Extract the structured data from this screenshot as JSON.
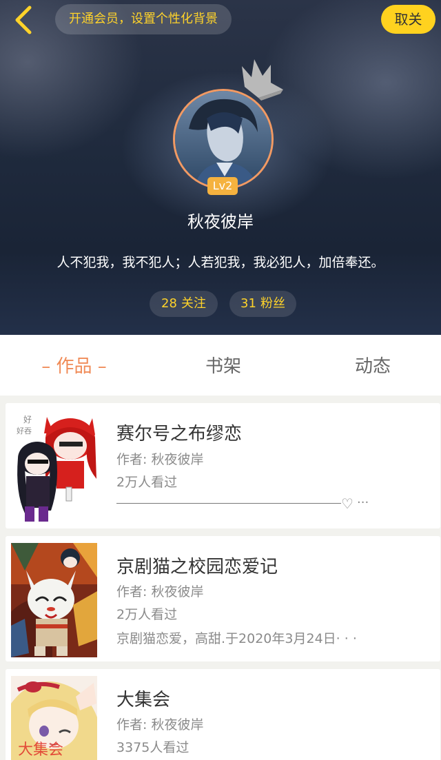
{
  "header": {
    "vip_prompt": "开通会员，设置个性化背景",
    "unfollow_label": "取关",
    "level": "Lv2",
    "username": "秋夜彼岸",
    "signature": "人不犯我，我不犯人；人若犯我，我必犯人，加倍奉还。",
    "following": {
      "count": "28",
      "label": "关注"
    },
    "followers": {
      "count": "31",
      "label": "粉丝"
    }
  },
  "tabs": [
    {
      "label": "– 作品 –",
      "active": true
    },
    {
      "label": "书架",
      "active": false
    },
    {
      "label": "动态",
      "active": false
    }
  ],
  "works": [
    {
      "title": "赛尔号之布缪恋",
      "author": "作者: 秋夜彼岸",
      "views": "2万人看过",
      "description": "",
      "icons": [
        "heart-icon",
        "more-icon"
      ]
    },
    {
      "title": "京剧猫之校园恋爱记",
      "author": "作者: 秋夜彼岸",
      "views": "2万人看过",
      "description": "京剧猫恋爱，高甜.于2020年3月24日· · ·"
    },
    {
      "title": "大集会",
      "author": "作者: 秋夜彼岸",
      "views": "3375人看过",
      "description": ""
    }
  ],
  "colors": {
    "accent": "#f08b57",
    "vip_yellow": "#ffd32a",
    "button_yellow": "#ffd21f",
    "level_badge": "#f5b23f"
  }
}
